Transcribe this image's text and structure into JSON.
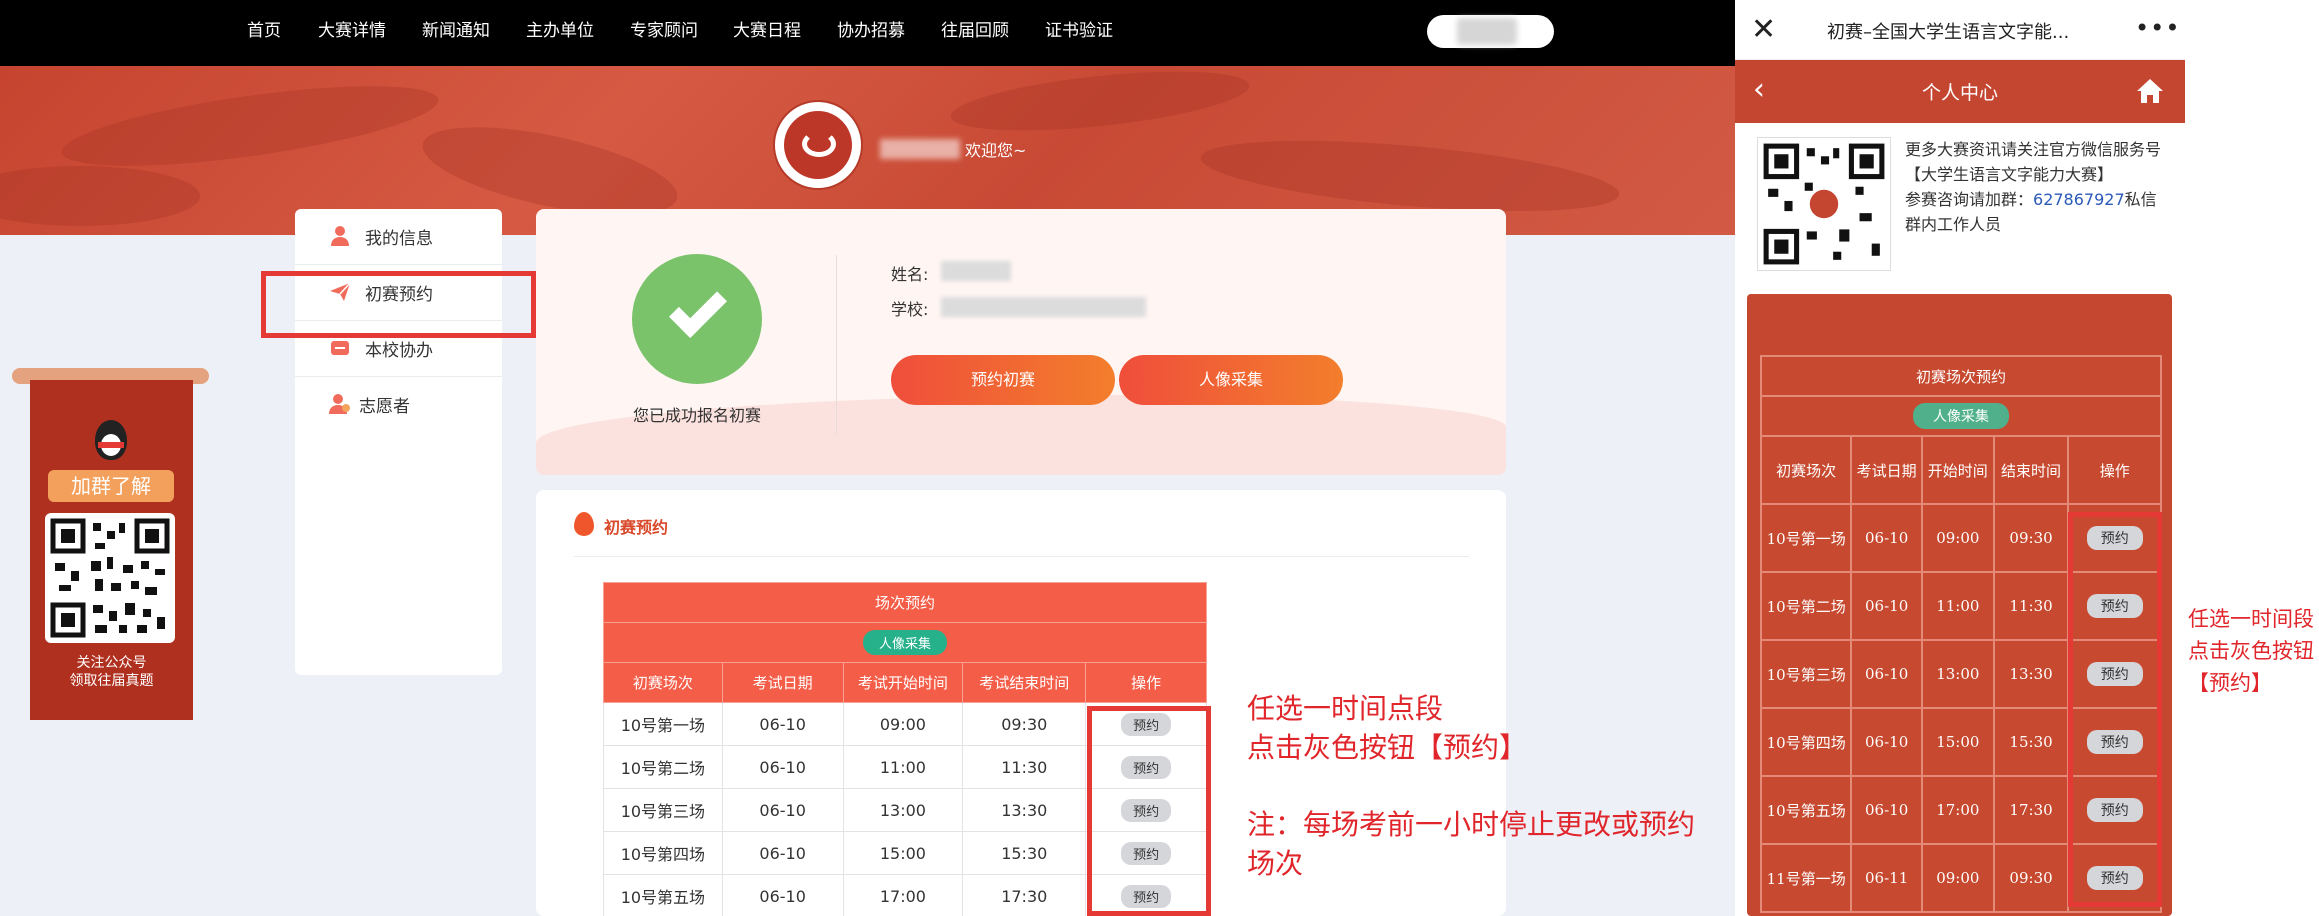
{
  "nav": [
    "首页",
    "大赛详情",
    "新闻通知",
    "主办单位",
    "专家顾问",
    "大赛日程",
    "协办招募",
    "往届回顾",
    "证书验证"
  ],
  "welcome": "欢迎您~",
  "sidebar": [
    "我的信息",
    "初赛预约",
    "本校协办",
    "志愿者"
  ],
  "profile": {
    "name_label": "姓名:",
    "school_label": "学校:",
    "status": "您已成功报名初赛",
    "btn_reserve": "预约初赛",
    "btn_photo": "人像采集"
  },
  "section_title": "初赛预约",
  "table": {
    "caption": "场次预约",
    "photo_btn": "人像采集",
    "headers": [
      "初赛场次",
      "考试日期",
      "考试开始时间",
      "考试结束时间",
      "操作"
    ],
    "rows": [
      [
        "10号第一场",
        "06-10",
        "09:00",
        "09:30",
        "预约"
      ],
      [
        "10号第二场",
        "06-10",
        "11:00",
        "11:30",
        "预约"
      ],
      [
        "10号第三场",
        "06-10",
        "13:00",
        "13:30",
        "预约"
      ],
      [
        "10号第四场",
        "06-10",
        "15:00",
        "15:30",
        "预约"
      ],
      [
        "10号第五场",
        "06-10",
        "17:00",
        "17:30",
        "预约"
      ]
    ]
  },
  "annotations": {
    "line1": "任选一时间点段",
    "line2": "点击灰色按钮【预约】",
    "note1": "注：每场考前一小时停止更改或预约",
    "note2": "场次"
  },
  "qr_ad": {
    "btn": "加群了解",
    "cap1": "关注公众号",
    "cap2": "领取往届真题"
  },
  "mobile": {
    "window_title": "初赛–全国大学生语言文字能...",
    "close": "✕",
    "more": "•••",
    "header": "个人中心",
    "info1": "更多大赛资讯请关注官方微信服务号【大学生语言文字能力大赛】",
    "info2_a": "参赛咨询请加群：",
    "group_no": "627867927",
    "info2_b": "私信群内工作人员",
    "table_caption": "初赛场次预约",
    "photo_btn": "人像采集",
    "headers": [
      "初赛场次",
      "考试日期",
      "开始时间",
      "结束时间",
      "操作"
    ],
    "rows": [
      [
        "10号第一场",
        "06-10",
        "09:00",
        "09:30",
        "预约"
      ],
      [
        "10号第二场",
        "06-10",
        "11:00",
        "11:30",
        "预约"
      ],
      [
        "10号第三场",
        "06-10",
        "13:00",
        "13:30",
        "预约"
      ],
      [
        "10号第四场",
        "06-10",
        "15:00",
        "15:30",
        "预约"
      ],
      [
        "10号第五场",
        "06-10",
        "17:00",
        "17:30",
        "预约"
      ],
      [
        "11号第一场",
        "06-11",
        "09:00",
        "09:30",
        "预约"
      ]
    ]
  },
  "right_annotation": {
    "l1": "任选一时间段",
    "l2": "点击灰色按钮",
    "l3": "【预约】"
  }
}
